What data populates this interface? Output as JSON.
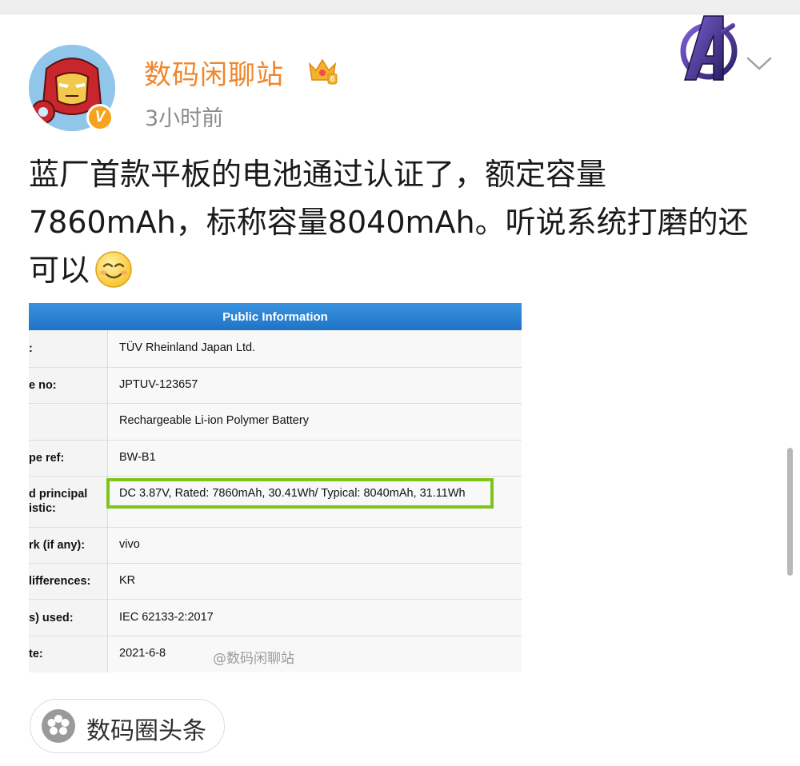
{
  "post": {
    "username": "数码闲聊站",
    "time": "3小时前",
    "text": "蓝厂首款平板的电池通过认证了，额定容量7860mAh，标称容量8040mAh。听说系统打磨的还可以",
    "emoji": "smile-emoji"
  },
  "badges": {
    "verified": "V",
    "crown_level": "6"
  },
  "certificate": {
    "header": "Public Information",
    "rows": [
      {
        "label": ":",
        "value": "TÜV Rheinland Japan Ltd."
      },
      {
        "label": "e no:",
        "value": "JPTUV-123657"
      },
      {
        "label": "",
        "value": "Rechargeable Li-ion Polymer Battery"
      },
      {
        "label": "pe ref:",
        "value": "BW-B1"
      },
      {
        "label": "d principal\nistic:",
        "value": "DC 3.87V, Rated: 7860mAh, 30.41Wh/ Typical: 8040mAh, 31.11Wh"
      },
      {
        "label": "rk (if any):",
        "value": "vivo"
      },
      {
        "label": "lifferences:",
        "value": "KR"
      },
      {
        "label": "s) used:",
        "value": "IEC 62133-2:2017"
      },
      {
        "label": "te:",
        "value": "2021-6-8"
      }
    ],
    "watermark": "@数码闲聊站",
    "highlight_color": "#7fc41b",
    "header_color": "#2a84d6"
  },
  "topic": {
    "label": "数码圈头条"
  },
  "colors": {
    "username": "#f0852b",
    "time": "#8c8c8c",
    "text": "#1a1a1a"
  }
}
